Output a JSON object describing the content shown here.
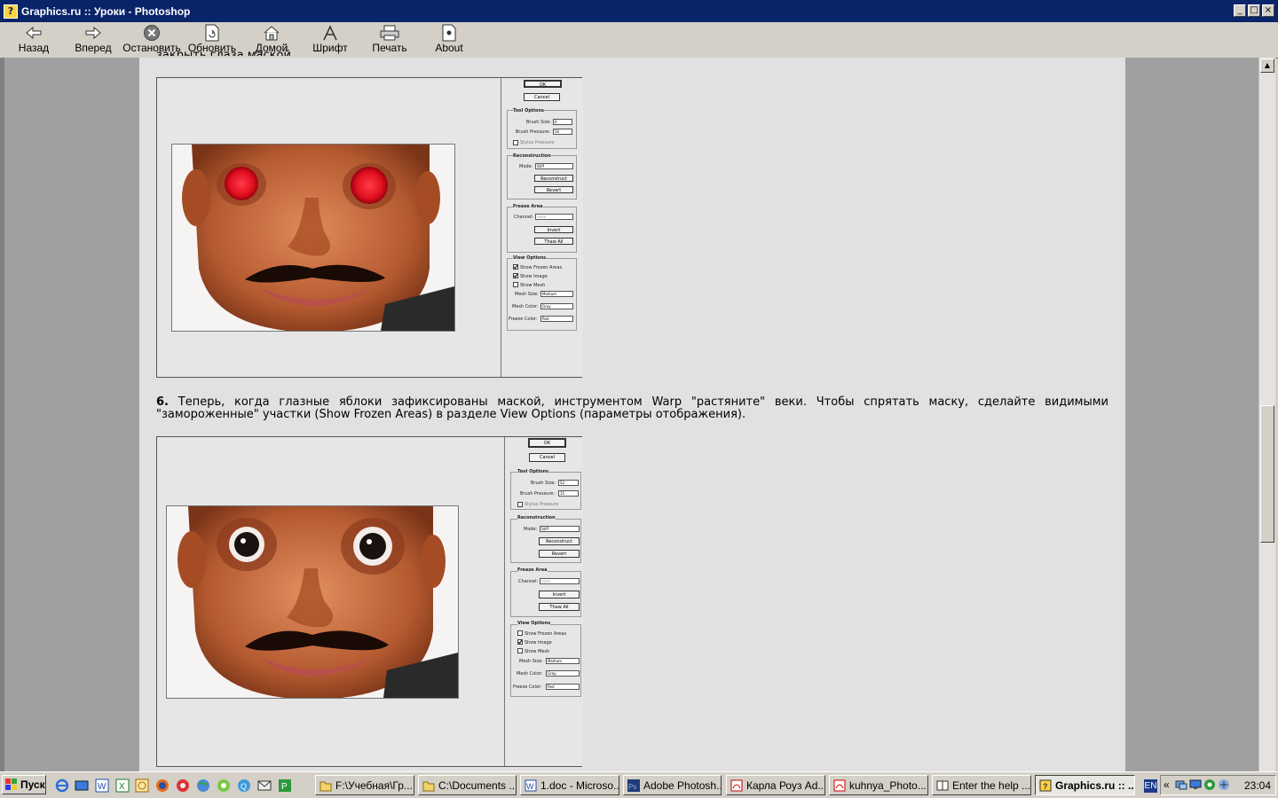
{
  "window": {
    "title": "Graphics.ru :: Уроки - Photoshop"
  },
  "toolbar": {
    "back": "Назад",
    "forward": "Вперед",
    "stop": "Остановить",
    "refresh": "Обновить",
    "home": "Домой",
    "font": "Шрифт",
    "print": "Печать",
    "about": "About"
  },
  "content": {
    "cut_text": "закрыть глаза маской.",
    "step_number": "6.",
    "step_text": " Теперь, когда глазные яблоки зафиксированы маской, инструментом Warp \"растяните\" веки. Чтобы спрятать маску, сделайте видимыми \"замороженные\" участки (Show Frozen Areas) в разделе View Options (параметры отображения)."
  },
  "dialog1": {
    "ok": "OK",
    "cancel": "Cancel",
    "tool_options": "Tool Options",
    "brush_size_label": "Brush Size:",
    "brush_size": "6",
    "brush_pressure_label": "Brush Pressure:",
    "brush_pressure": "50",
    "stylus_pressure": "Stylus Pressure",
    "reconstruction": "Reconstruction",
    "mode_label": "Mode:",
    "mode": "Stiff",
    "reconstruct": "Reconstruct",
    "revert": "Revert",
    "freeze_area": "Freeze Area",
    "channel_label": "Channel:",
    "channel": "none",
    "invert": "Invert",
    "thaw_all": "Thaw All",
    "view_options": "View Options",
    "show_frozen": "Show Frozen Areas",
    "show_image": "Show Image",
    "show_mesh": "Show Mesh",
    "mesh_size_label": "Mesh Size:",
    "mesh_size": "Medium",
    "mesh_color_label": "Mesh Color:",
    "mesh_color": "Gray",
    "freeze_color_label": "Freeze Color:",
    "freeze_color": "Red"
  },
  "dialog2": {
    "ok": "OK",
    "cancel": "Cancel",
    "tool_options": "Tool Options",
    "brush_size_label": "Brush Size:",
    "brush_size": "52",
    "brush_pressure_label": "Brush Pressure:",
    "brush_pressure": "15",
    "stylus_pressure": "Stylus Pressure",
    "reconstruction": "Reconstruction",
    "mode_label": "Mode:",
    "mode": "Stiff",
    "reconstruct": "Reconstruct",
    "revert": "Revert",
    "freeze_area": "Freeze Area",
    "channel_label": "Channel:",
    "channel": "none",
    "invert": "Invert",
    "thaw_all": "Thaw All",
    "view_options": "View Options",
    "show_frozen": "Show Frozen Areas",
    "show_image": "Show Image",
    "show_mesh": "Show Mesh",
    "mesh_size_label": "Mesh Size:",
    "mesh_size": "Medium",
    "mesh_color_label": "Mesh Color:",
    "mesh_color": "Gray",
    "freeze_color_label": "Freeze Color:",
    "freeze_color": "Red"
  },
  "taskbar": {
    "start": "Пуск",
    "tasks": [
      "F:\\Учебная\\Гр...",
      "C:\\Documents ...",
      "1.doc - Microso...",
      "Adobe Photosh...",
      "Карла Роуз Ad...",
      "kuhnya_Photo...",
      "Enter the help ...",
      "Graphics.ru :: ..."
    ],
    "lang": "EN",
    "clock": "23:04"
  },
  "colors": {
    "titlebar": "#0a246a",
    "content_bg": "#e1e1e1",
    "side_gray": "#a0a0a0"
  }
}
